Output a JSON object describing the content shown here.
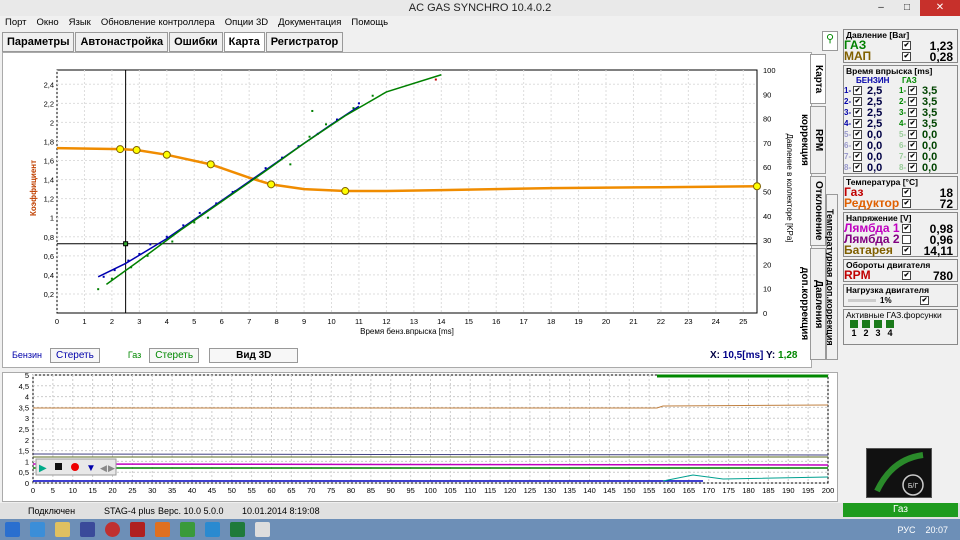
{
  "title": "AC GAS SYNCHRO  10.4.0.2",
  "window": {
    "minimize": "–",
    "maximize": "□",
    "close": "✕"
  },
  "menu": [
    "Порт",
    "Окно",
    "Язык",
    "Обновление контроллера",
    "Опции 3D",
    "Документация",
    "Помощь"
  ],
  "tabs": [
    "Параметры",
    "Автонастройка",
    "Ошибки",
    "Карта",
    "Регистратор"
  ],
  "vtabs": [
    "Карта",
    "RPM коррекция",
    "Отклонение",
    "Температурная доп.коррекция",
    "Давления доп.коррекция"
  ],
  "chart_data": {
    "type": "line",
    "xlabel": "Время бенз.впрыска [ms]",
    "ylabel_left": "Коэффициент",
    "ylabel_right": "Давление в коллекторе [KPa]",
    "xlim": [
      0,
      25.5
    ],
    "ylim_left": [
      0,
      2.55
    ],
    "ylim_right": [
      0,
      100
    ],
    "x_ticks": [
      0,
      1,
      2,
      3,
      4,
      5,
      6,
      7,
      8,
      9,
      10,
      11,
      12,
      13,
      14,
      15,
      16,
      17,
      18,
      19,
      20,
      21,
      22,
      23,
      24,
      25
    ],
    "y_ticks_left": [
      0.2,
      0.4,
      0.6,
      0.8,
      1,
      1.2,
      1.4,
      1.6,
      1.8,
      2,
      2.2,
      2.4
    ],
    "y_ticks_right": [
      0,
      10,
      20,
      30,
      40,
      50,
      60,
      70,
      80,
      90,
      100
    ],
    "series": [
      {
        "color": "#f08c00",
        "points": [
          [
            0,
            1.73
          ],
          [
            2.3,
            1.72
          ],
          [
            2.9,
            1.71
          ],
          [
            4,
            1.66
          ],
          [
            5.6,
            1.56
          ],
          [
            7,
            1.42
          ],
          [
            7.8,
            1.35
          ],
          [
            9,
            1.3
          ],
          [
            10.5,
            1.28
          ],
          [
            12,
            1.28
          ],
          [
            14,
            1.29
          ],
          [
            18,
            1.31
          ],
          [
            22,
            1.32
          ],
          [
            25.5,
            1.33
          ]
        ],
        "markers": [
          [
            2.3,
            1.72
          ],
          [
            2.9,
            1.71
          ],
          [
            4,
            1.66
          ],
          [
            5.6,
            1.56
          ],
          [
            7.8,
            1.35
          ],
          [
            10.5,
            1.28
          ],
          [
            25.5,
            1.33
          ]
        ]
      },
      {
        "color": "#0000b0",
        "points": [
          [
            1.5,
            0.38
          ],
          [
            2.5,
            0.52
          ],
          [
            4,
            0.78
          ],
          [
            5.5,
            1.08
          ],
          [
            7,
            1.38
          ],
          [
            8.5,
            1.68
          ],
          [
            10,
            1.98
          ],
          [
            11,
            2.17
          ]
        ]
      },
      {
        "color": "#008000",
        "points": [
          [
            1.8,
            0.3
          ],
          [
            3,
            0.55
          ],
          [
            4.5,
            0.87
          ],
          [
            6,
            1.17
          ],
          [
            7.5,
            1.47
          ],
          [
            9,
            1.78
          ],
          [
            10.5,
            2.07
          ],
          [
            12,
            2.32
          ],
          [
            14,
            2.5
          ]
        ]
      }
    ],
    "crosshair": {
      "x": 2.5,
      "y_right": 28.5
    }
  },
  "controls": {
    "benzin_label": "Бензин",
    "benzin_clear": "Стереть",
    "gas_label": "Газ",
    "gas_clear": "Стереть",
    "view3d": "Вид 3D",
    "x_label": "X:",
    "x_value": "10,5[ms]",
    "y_label": "Y:",
    "y_value": "1,28"
  },
  "pressure": {
    "title": "Давление [Bar]",
    "rows": [
      {
        "label": "ГАЗ",
        "value": "1,23",
        "color": "#008000"
      },
      {
        "label": "МАП",
        "value": "0,28",
        "color": "#806000"
      }
    ]
  },
  "injection": {
    "title": "Время впрыска [ms]",
    "benzin_head": "БЕНЗИН",
    "gas_head": "ГАЗ",
    "rows": [
      [
        "1-",
        "2,5",
        "1-",
        "3,5"
      ],
      [
        "2-",
        "2,5",
        "2-",
        "3,5"
      ],
      [
        "3-",
        "2,5",
        "3-",
        "3,5"
      ],
      [
        "4-",
        "2,5",
        "4-",
        "3,5"
      ],
      [
        "5-",
        "0,0",
        "5-",
        "0,0"
      ],
      [
        "6-",
        "0,0",
        "6-",
        "0,0"
      ],
      [
        "7-",
        "0,0",
        "7-",
        "0,0"
      ],
      [
        "8-",
        "0,0",
        "8-",
        "0,0"
      ]
    ]
  },
  "temperature": {
    "title": "Температура [°C]",
    "rows": [
      {
        "label": "Газ",
        "value": "18",
        "color": "#c00000"
      },
      {
        "label": "Редуктор",
        "value": "72",
        "color": "#e06000"
      }
    ]
  },
  "voltage": {
    "title": "Напряжение [V]",
    "rows": [
      {
        "label": "Лямбда 1",
        "value": "0,98",
        "color": "#c000c0"
      },
      {
        "label": "Лямбда 2",
        "value": "0,96",
        "color": "#800080"
      },
      {
        "label": "Батарея",
        "value": "14,11",
        "color": "#806000"
      }
    ]
  },
  "rpm": {
    "title": "Обороты двигателя",
    "label": "RPM",
    "value": "780"
  },
  "load": {
    "title": "Нагрузка двигателя",
    "value": "1%"
  },
  "injectors": {
    "title": "Активные ГАЗ.форсунки",
    "nums": [
      "1",
      "2",
      "3",
      "4"
    ]
  },
  "bottom_chart": {
    "y_ticks": [
      0,
      0.5,
      1,
      1.5,
      2,
      2.5,
      3,
      3.5,
      4,
      4.5,
      5
    ],
    "x_ticks": [
      0,
      5,
      10,
      15,
      20,
      25,
      30,
      35,
      40,
      45,
      50,
      55,
      60,
      65,
      70,
      75,
      80,
      85,
      90,
      95,
      100,
      105,
      110,
      115,
      120,
      125,
      130,
      135,
      140,
      145,
      150,
      155,
      160,
      165,
      170,
      175,
      180,
      185,
      190,
      195,
      200
    ]
  },
  "status": {
    "connected": "Подключен",
    "device": "STAG-4 plus",
    "version": "Верс. 10.0  5.0.0",
    "date": "10.01.2014 8:19:08",
    "gas": "Газ"
  },
  "tray": {
    "lang": "РУС",
    "time": "20:07"
  },
  "logo_text": "Б/Г"
}
